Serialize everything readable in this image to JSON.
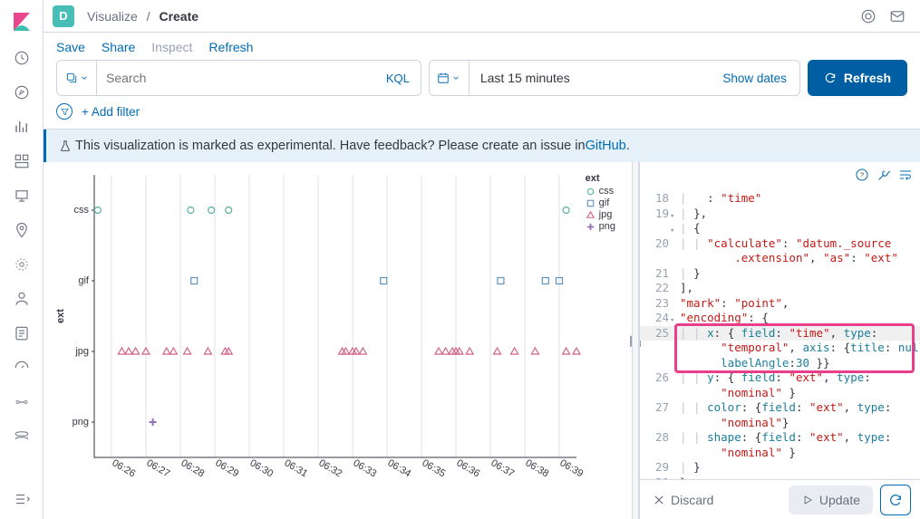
{
  "header": {
    "space_initial": "D",
    "breadcrumb_root": "Visualize",
    "breadcrumb_current": "Create"
  },
  "menu": {
    "save": "Save",
    "share": "Share",
    "inspect": "Inspect",
    "refresh": "Refresh"
  },
  "query": {
    "placeholder": "Search",
    "kql_label": "KQL",
    "time_range": "Last 15 minutes",
    "show_dates": "Show dates",
    "refresh_btn": "Refresh"
  },
  "filter": {
    "add_filter": "+ Add filter"
  },
  "callout": {
    "prefix": "This visualization is marked as experimental. Have feedback? Please create an issue in ",
    "link": "GitHub",
    "suffix": "."
  },
  "legend": {
    "title": "ext",
    "items": [
      {
        "label": "css",
        "shape": "circle",
        "color": "#54b399"
      },
      {
        "label": "gif",
        "shape": "square",
        "color": "#6092c0"
      },
      {
        "label": "jpg",
        "shape": "triangle",
        "color": "#d36086"
      },
      {
        "label": "png",
        "shape": "plus",
        "color": "#9170b8"
      }
    ]
  },
  "chart_data": {
    "type": "scatter",
    "xlabel": "",
    "ylabel": "ext",
    "x_ticks": [
      "06:26",
      "06:27",
      "06:28",
      "06:29",
      "06:30",
      "06:31",
      "06:32",
      "06:33",
      "06:34",
      "06:35",
      "06:36",
      "06:37",
      "06:38",
      "06:39"
    ],
    "y_categories": [
      "css",
      "gif",
      "jpg",
      "png"
    ],
    "series": [
      {
        "name": "css",
        "shape": "circle",
        "color": "#54b399",
        "points": [
          {
            "x": "06:25.6"
          },
          {
            "x": "06:28.3"
          },
          {
            "x": "06:28.9"
          },
          {
            "x": "06:29.4"
          },
          {
            "x": "06:39.2"
          }
        ]
      },
      {
        "name": "gif",
        "shape": "square",
        "color": "#6092c0",
        "points": [
          {
            "x": "06:28.4"
          },
          {
            "x": "06:33.9"
          },
          {
            "x": "06:37.3"
          },
          {
            "x": "06:38.6"
          },
          {
            "x": "06:39.0"
          }
        ]
      },
      {
        "name": "jpg",
        "shape": "triangle",
        "color": "#d36086",
        "points": [
          {
            "x": "06:26.3"
          },
          {
            "x": "06:26.5"
          },
          {
            "x": "06:26.7"
          },
          {
            "x": "06:27.0"
          },
          {
            "x": "06:27.6"
          },
          {
            "x": "06:27.8"
          },
          {
            "x": "06:28.2"
          },
          {
            "x": "06:28.8"
          },
          {
            "x": "06:29.3"
          },
          {
            "x": "06:29.4"
          },
          {
            "x": "06:32.7"
          },
          {
            "x": "06:32.8"
          },
          {
            "x": "06:33.0"
          },
          {
            "x": "06:33.1"
          },
          {
            "x": "06:33.3"
          },
          {
            "x": "06:35.5"
          },
          {
            "x": "06:35.7"
          },
          {
            "x": "06:35.9"
          },
          {
            "x": "06:36.0"
          },
          {
            "x": "06:36.1"
          },
          {
            "x": "06:36.4"
          },
          {
            "x": "06:37.2"
          },
          {
            "x": "06:37.7"
          },
          {
            "x": "06:38.3"
          },
          {
            "x": "06:39.2"
          },
          {
            "x": "06:39.5"
          }
        ]
      },
      {
        "name": "png",
        "shape": "plus",
        "color": "#9170b8",
        "points": [
          {
            "x": "06:27.2"
          }
        ]
      }
    ]
  },
  "code": {
    "lines": [
      {
        "n": 18,
        "raw": "      : \"time\"",
        "html": "<span class='tok-guide'>|   </span>: <span class='tok-str'>\"time\"</span>"
      },
      {
        "n": 19,
        "fold": "▾",
        "raw": "    },",
        "html": "<span class='tok-guide'>| </span>},"
      },
      {
        "n": 19.5,
        "fold": "▾",
        "raw": "    {",
        "html": "<span class='tok-guide'>| </span>{"
      },
      {
        "n": 20,
        "raw": "      \"calculate\": \"datum._source",
        "html": "<span class='tok-guide'>| | </span><span class='tok-str'>\"calculate\"</span>: <span class='tok-str'>\"datum._source</span>"
      },
      {
        "n": 20.5,
        "raw": "        .extension\", \"as\": \"ext\"",
        "html": "        <span class='tok-str'>.extension\"</span>, <span class='tok-str'>\"as\"</span>: <span class='tok-str'>\"ext\"</span>"
      },
      {
        "n": 21,
        "raw": "    }",
        "html": "<span class='tok-guide'>| </span>}"
      },
      {
        "n": 22,
        "raw": "  ],",
        "html": "],"
      },
      {
        "n": 23,
        "raw": "  \"mark\": \"point\",",
        "html": "<span class='tok-str'>\"mark\"</span>: <span class='tok-str'>\"point\"</span>,"
      },
      {
        "n": 24,
        "fold": "▾",
        "raw": "  \"encoding\": {",
        "html": "<span class='tok-str'>\"encoding\"</span>: {"
      },
      {
        "n": 25,
        "hl": true,
        "raw": "    x: { field: \"time\", type:",
        "html": "<span class='tok-guide'>| | </span><span class='tok-key'>x</span>: { <span class='tok-key'>field</span>: <span class='tok-str'>\"time\"</span>, <span class='tok-key'>type</span>:"
      },
      {
        "n": 25.3,
        "hl": true,
        "raw": "      \"temporal\", axis: {title: null,",
        "html": "      <span class='tok-str'>\"temporal\"</span>, <span class='tok-key'>axis</span>: {<span class='tok-key'>title</span>: <span class='tok-key'>null</span>,"
      },
      {
        "n": 25.6,
        "hl": true,
        "raw": "      labelAngle:30 }}",
        "html": "      <span class='tok-key'>labelAngle</span>:<span class='tok-key'>30</span> }}"
      },
      {
        "n": 26,
        "raw": "    y: { field: \"ext\", type:",
        "html": "<span class='tok-guide'>| | </span><span class='tok-key'>y</span>: { <span class='tok-key'>field</span>: <span class='tok-str'>\"ext\"</span>, <span class='tok-key'>type</span>:"
      },
      {
        "n": 26.5,
        "raw": "      \"nominal\" }",
        "html": "      <span class='tok-str'>\"nominal\"</span> }"
      },
      {
        "n": 27,
        "raw": "    color: {field: \"ext\", type:",
        "html": "<span class='tok-guide'>| | </span><span class='tok-key'>color</span>: {<span class='tok-key'>field</span>: <span class='tok-str'>\"ext\"</span>, <span class='tok-key'>type</span>:"
      },
      {
        "n": 27.5,
        "raw": "      \"nominal\"}",
        "html": "      <span class='tok-str'>\"nominal\"</span>}"
      },
      {
        "n": 28,
        "raw": "    shape: {field: \"ext\", type:",
        "html": "<span class='tok-guide'>| | </span><span class='tok-key'>shape</span>: {<span class='tok-key'>field</span>: <span class='tok-str'>\"ext\"</span>, <span class='tok-key'>type</span>:"
      },
      {
        "n": 28.5,
        "raw": "      \"nominal\" }",
        "html": "      <span class='tok-str'>\"nominal\"</span> }"
      },
      {
        "n": 29,
        "raw": "  }",
        "html": "<span class='tok-guide'>| </span>}"
      },
      {
        "n": 30,
        "raw": "}",
        "html": "}"
      }
    ]
  },
  "editor_footer": {
    "discard": "Discard",
    "update": "Update"
  }
}
